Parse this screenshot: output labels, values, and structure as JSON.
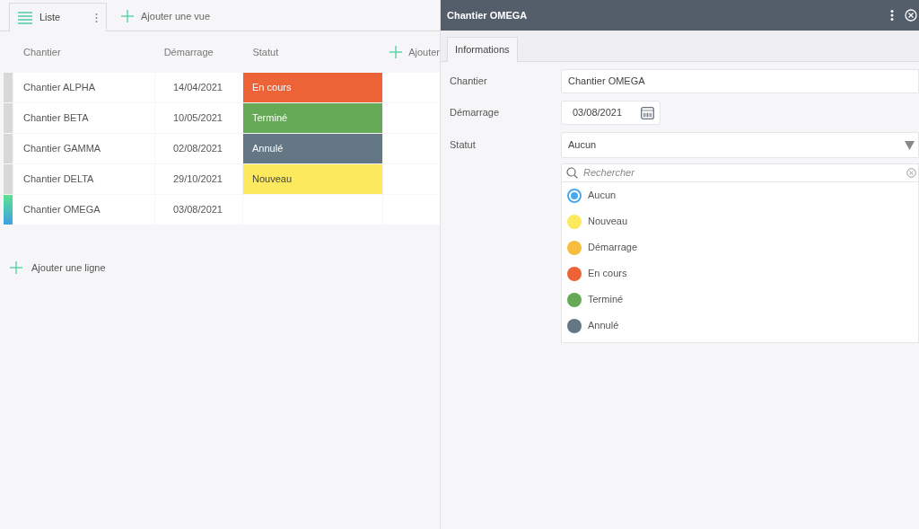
{
  "view_tabs": [
    {
      "label": "Liste",
      "selected": true
    }
  ],
  "add_view": "Ajouter une vue",
  "table": {
    "columns": [
      "Chantier",
      "Démarrage",
      "Statut"
    ],
    "add_column": "Ajouter",
    "rows": [
      {
        "name": "Chantier ALPHA",
        "date": "14/04/2021",
        "status": "En cours",
        "color": "#ec6337",
        "selected": false
      },
      {
        "name": "Chantier BETA",
        "date": "10/05/2021",
        "status": "Terminé",
        "color": "#66aa58",
        "selected": false
      },
      {
        "name": "Chantier GAMMA",
        "date": "02/08/2021",
        "status": "Annulé",
        "color": "#637784",
        "selected": false
      },
      {
        "name": "Chantier DELTA",
        "date": "29/10/2021",
        "status": "Nouveau",
        "color": "#fde95e",
        "selected": false
      },
      {
        "name": "Chantier OMEGA",
        "date": "03/08/2021",
        "selected": true
      }
    ]
  },
  "add_row": "Ajouter une ligne",
  "panel": {
    "title": "Chantier OMEGA",
    "tabs": [
      {
        "label": "Informations",
        "selected": true
      }
    ],
    "fields": [
      {
        "label": "Chantier",
        "value": "Chantier OMEGA",
        "kind": "text"
      },
      {
        "label": "Démarrage",
        "value": "03/08/2021",
        "kind": "date"
      },
      {
        "label": "Statut",
        "value": "Aucun",
        "kind": "select"
      }
    ],
    "dropdown": {
      "search_placeholder": "Rechercher",
      "options": [
        {
          "label": "Aucun",
          "kind": "radio",
          "selected": true
        },
        {
          "label": "Nouveau",
          "kind": "dot",
          "color": "#fde95e",
          "selected": false
        },
        {
          "label": "Démarrage",
          "kind": "dot",
          "color": "#f6bd3e",
          "selected": false
        },
        {
          "label": "En cours",
          "kind": "dot",
          "color": "#ec6337",
          "selected": false
        },
        {
          "label": "Terminé",
          "kind": "dot",
          "color": "#66aa58",
          "selected": false
        },
        {
          "label": "Annulé",
          "kind": "dot",
          "color": "#637784",
          "selected": false
        }
      ]
    }
  }
}
